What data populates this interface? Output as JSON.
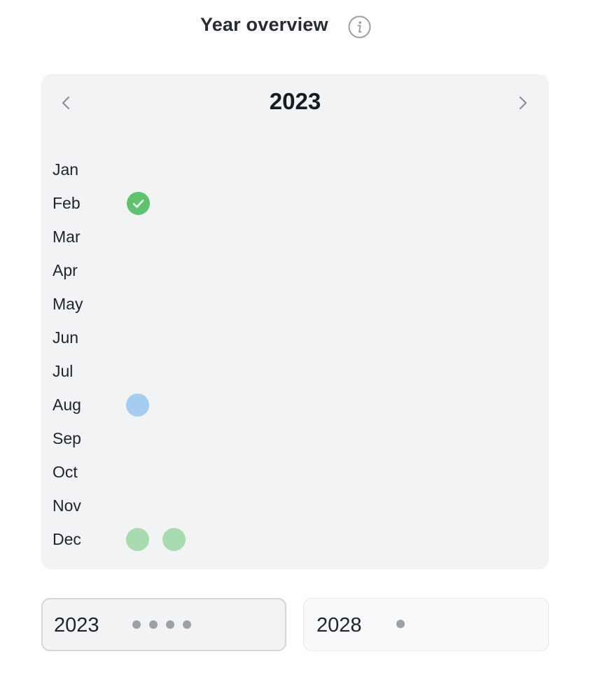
{
  "header": {
    "title": "Year overview",
    "info_icon": "info-icon"
  },
  "calendar": {
    "year": "2023",
    "prev_icon": "chevron-left-icon",
    "next_icon": "chevron-right-icon",
    "months": [
      {
        "label": "Jan",
        "markers": []
      },
      {
        "label": "Feb",
        "markers": [
          {
            "status": "completed",
            "icon": "check-icon"
          }
        ]
      },
      {
        "label": "Mar",
        "markers": []
      },
      {
        "label": "Apr",
        "markers": []
      },
      {
        "label": "May",
        "markers": []
      },
      {
        "label": "Jun",
        "markers": []
      },
      {
        "label": "Jul",
        "markers": []
      },
      {
        "label": "Aug",
        "markers": [
          {
            "status": "scheduled"
          }
        ]
      },
      {
        "label": "Sep",
        "markers": []
      },
      {
        "label": "Oct",
        "markers": []
      },
      {
        "label": "Nov",
        "markers": []
      },
      {
        "label": "Dec",
        "markers": [
          {
            "status": "planned"
          },
          {
            "status": "planned"
          }
        ]
      }
    ]
  },
  "year_tabs": [
    {
      "year": "2023",
      "dot_count": 4,
      "selected": true
    },
    {
      "year": "2028",
      "dot_count": 1,
      "selected": false
    }
  ],
  "colors": {
    "completed": "#5cc46a",
    "scheduled": "#a5cdf0",
    "planned": "#a8dcae",
    "card_background": "#f2f3f5",
    "dot": "#9ca0a8"
  }
}
